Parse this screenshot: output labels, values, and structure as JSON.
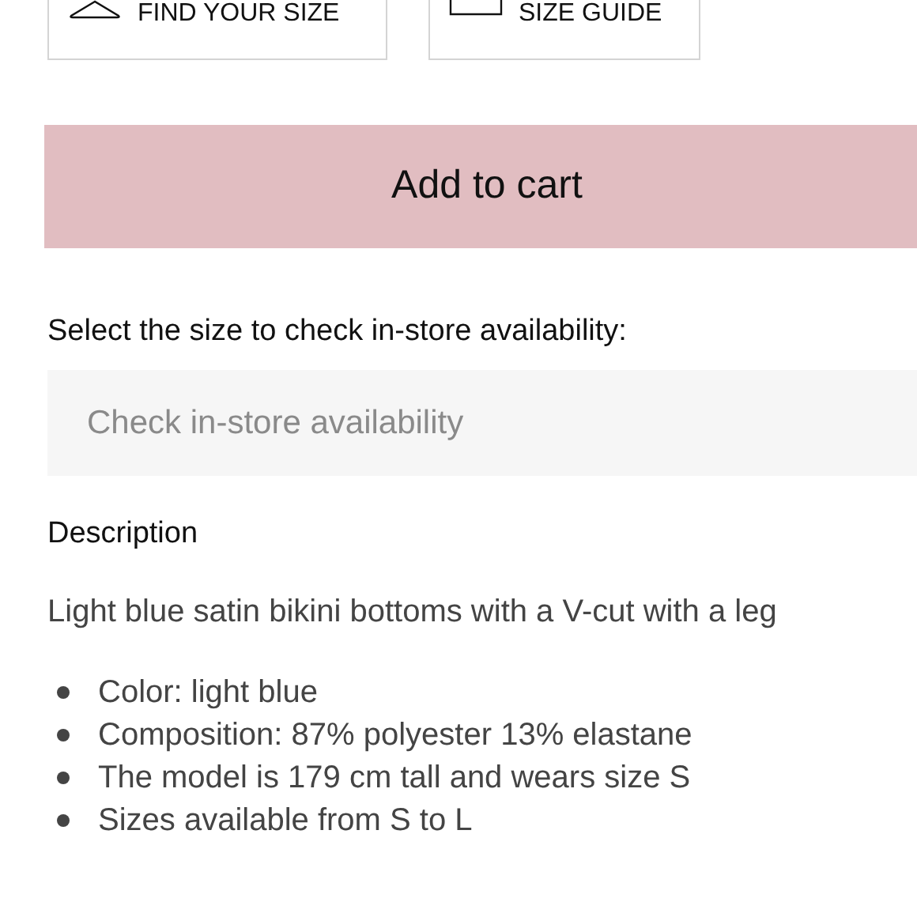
{
  "size_buttons": [
    {
      "kind": "hanger",
      "label": "FIND YOUR SIZE"
    },
    {
      "kind": "ruler",
      "label": "SIZE GUIDE"
    }
  ],
  "add_to_cart": {
    "label": "Add to cart"
  },
  "store_check": {
    "label": "Select the size to check in-store availability:",
    "select": {
      "placeholder": "Check in-store availability"
    }
  },
  "description": {
    "heading": "Description",
    "text": "Light blue satin bikini bottoms with a V-cut with a leg",
    "details": [
      "Color: light blue",
      "Composition: 87% polyester 13% elastane",
      "The model is 179 cm tall and wears size S",
      "Sizes available from S to L"
    ]
  }
}
